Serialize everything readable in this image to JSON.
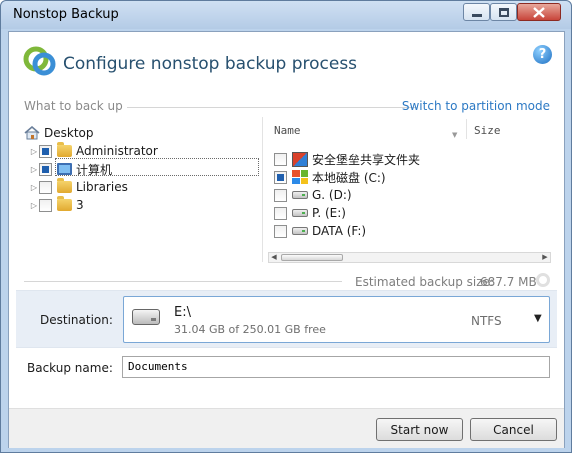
{
  "window": {
    "title": "Nonstop Backup"
  },
  "header": {
    "title": "Configure nonstop backup process",
    "help_icon": "?"
  },
  "what_to_back_up": {
    "label": "What to back up",
    "switch_link": "Switch to partition mode"
  },
  "tree": [
    {
      "label": "Desktop",
      "icon": "home-icon"
    },
    {
      "label": "Administrator",
      "icon": "user-folder-icon",
      "checked": "partial"
    },
    {
      "label": "计算机",
      "icon": "computer-icon",
      "checked": "partial"
    },
    {
      "label": "Libraries",
      "icon": "folder-icon",
      "checked": "unchecked"
    },
    {
      "label": "3",
      "icon": "folder-icon",
      "checked": "unchecked"
    }
  ],
  "file_list": {
    "columns": {
      "name": "Name",
      "size": "Size"
    },
    "rows": [
      {
        "label": "安全堡垒共享文件夹",
        "icon": "app-folder-icon",
        "checked": "unchecked"
      },
      {
        "label": "本地磁盘 (C:)",
        "icon": "windows-drive-icon",
        "checked": "partial"
      },
      {
        "label": "G. (D:)",
        "icon": "drive-icon",
        "checked": "unchecked"
      },
      {
        "label": "P. (E:)",
        "icon": "drive-icon",
        "checked": "unchecked"
      },
      {
        "label": "DATA (F:)",
        "icon": "drive-icon",
        "checked": "unchecked"
      }
    ]
  },
  "estimate": {
    "label": "Estimated backup size:",
    "value": "687.7 MB"
  },
  "destination": {
    "label": "Destination:",
    "path": "E:\\",
    "free": "31.04 GB of 250.01 GB free",
    "filesystem": "NTFS",
    "arrow": "▼"
  },
  "backup_name": {
    "label": "Backup name:",
    "value": "Documents"
  },
  "buttons": {
    "start": "Start now",
    "cancel": "Cancel"
  },
  "colors": {
    "accent": "#2c79c4",
    "title": "#27506f"
  }
}
